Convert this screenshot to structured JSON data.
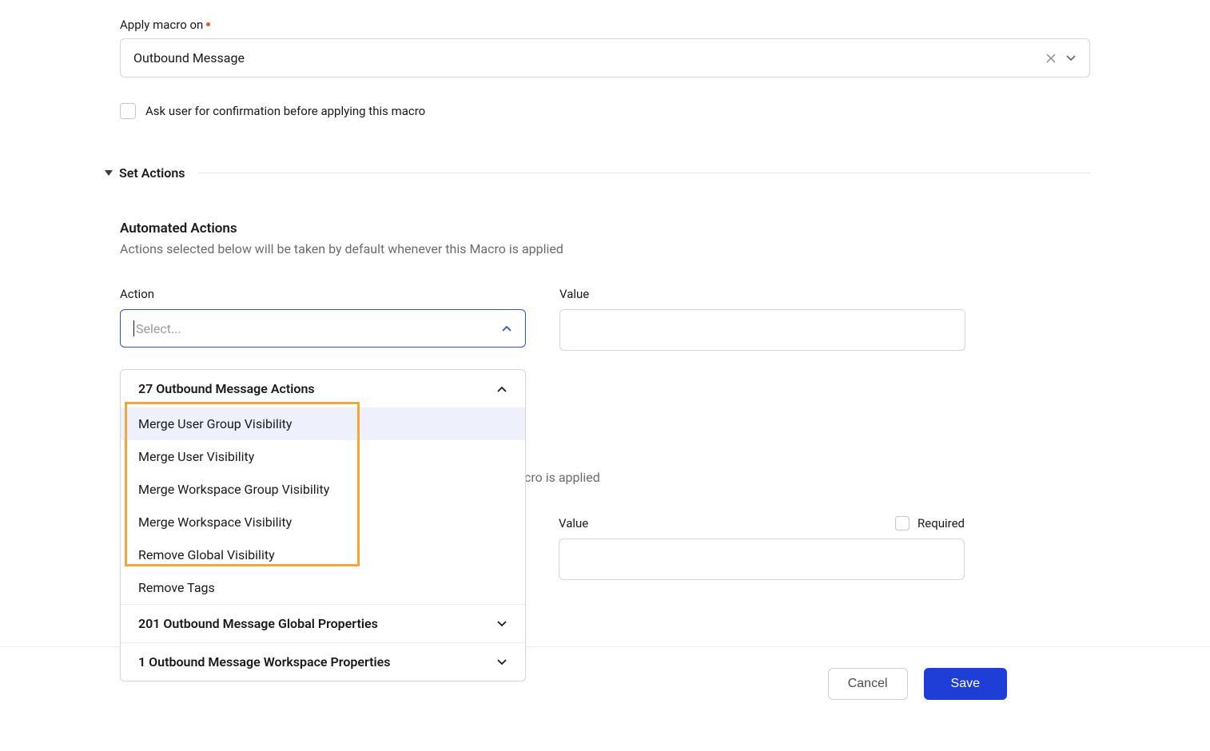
{
  "applyMacroOn": {
    "label": "Apply macro on",
    "value": "Outbound Message"
  },
  "confirmation": {
    "label": "Ask user for confirmation before applying this macro"
  },
  "setActions": {
    "title": "Set Actions"
  },
  "automatedActions": {
    "title": "Automated Actions",
    "description": "Actions selected below will be taken by default whenever this Macro is applied"
  },
  "actionField": {
    "label": "Action",
    "placeholder": "Select..."
  },
  "valueField": {
    "label": "Value"
  },
  "dropdown": {
    "group1": {
      "header": "27 Outbound Message Actions",
      "items": [
        "Merge User Group Visibility",
        "Merge User Visibility",
        "Merge Workspace Group Visibility",
        "Merge Workspace Visibility",
        "Remove Global Visibility",
        "Remove Tags"
      ]
    },
    "group2": {
      "header": "201 Outbound Message Global Properties"
    },
    "group3": {
      "header": "1 Outbound Message Workspace Properties"
    }
  },
  "behindText": "cro is applied",
  "valueField2": {
    "label": "Value",
    "requiredLabel": "Required"
  },
  "footer": {
    "cancel": "Cancel",
    "save": "Save"
  }
}
